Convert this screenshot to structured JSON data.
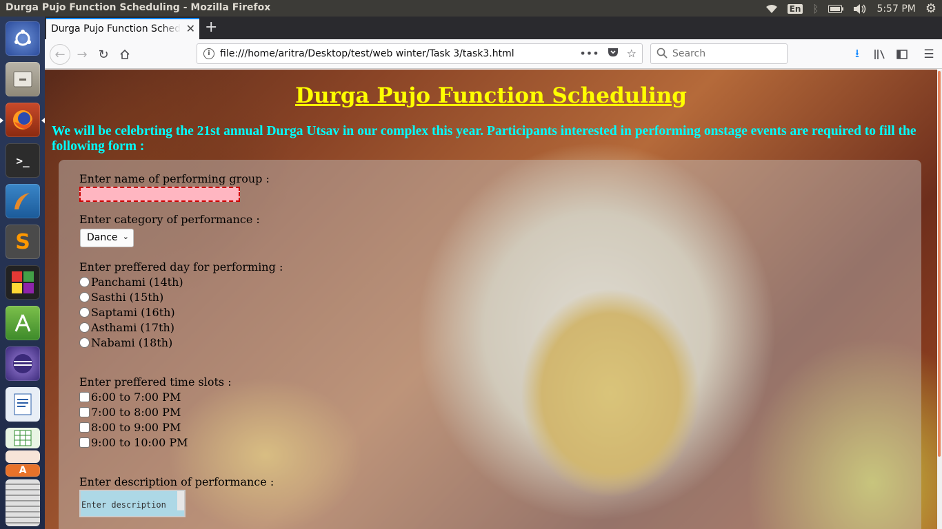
{
  "os": {
    "window_title": "Durga Pujo Function Scheduling - Mozilla Firefox",
    "keyboard_layout": "En",
    "clock": "5:57 PM"
  },
  "browser": {
    "tab_title": "Durga Pujo Function Scheduling",
    "url": "file:///home/aritra/Desktop/test/web winter/Task 3/task3.html",
    "search_placeholder": "Search"
  },
  "page": {
    "title": "Durga Pujo Function Scheduling",
    "intro": "We will be celebrting the 21st annual Durga Utsav in our complex this year. Participants interested in performing onstage events are required to fill the following form :",
    "form": {
      "group_label": "Enter name of performing group :",
      "group_value": "",
      "category_label": "Enter category of performance :",
      "category_value": "Dance",
      "day_label": "Enter preffered day for performing :",
      "days": [
        "Panchami (14th)",
        "Sasthi (15th)",
        "Saptami (16th)",
        "Asthami (17th)",
        "Nabami (18th)"
      ],
      "time_label": "Enter preffered time slots :",
      "times": [
        "6:00 to 7:00 PM",
        "7:00 to 8:00 PM",
        "8:00 to 9:00 PM",
        "9:00 to 10:00 PM"
      ],
      "description_label": "Enter description of performance :",
      "description_placeholder": "Enter description"
    }
  }
}
